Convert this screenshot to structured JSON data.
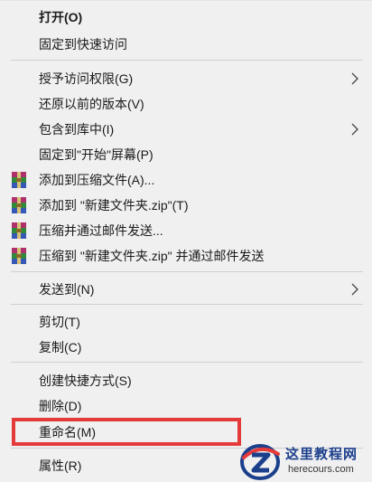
{
  "menu": {
    "items": [
      {
        "label": "打开(O)",
        "bold": true
      },
      {
        "label": "固定到快速访问"
      },
      {
        "label": "授予访问权限(G)",
        "submenu": true
      },
      {
        "label": "还原以前的版本(V)"
      },
      {
        "label": "包含到库中(I)",
        "submenu": true
      },
      {
        "label": "固定到\"开始\"屏幕(P)"
      },
      {
        "label": "添加到压缩文件(A)...",
        "icon": "winrar-icon"
      },
      {
        "label": "添加到 \"新建文件夹.zip\"(T)",
        "icon": "winrar-icon"
      },
      {
        "label": "压缩并通过邮件发送...",
        "icon": "winrar-icon"
      },
      {
        "label": "压缩到 \"新建文件夹.zip\" 并通过邮件发送",
        "icon": "winrar-icon"
      },
      {
        "label": "发送到(N)",
        "submenu": true
      },
      {
        "label": "剪切(T)"
      },
      {
        "label": "复制(C)"
      },
      {
        "label": "创建快捷方式(S)"
      },
      {
        "label": "删除(D)"
      },
      {
        "label": "重命名(M)",
        "highlighted": true
      },
      {
        "label": "属性(R)"
      }
    ]
  },
  "colors": {
    "menu_background": "#f0f0f0",
    "highlight_border": "#e53a3a",
    "separator": "#cfcfcf"
  },
  "watermark": {
    "title": "这里教程网",
    "url": "herecours.com"
  }
}
